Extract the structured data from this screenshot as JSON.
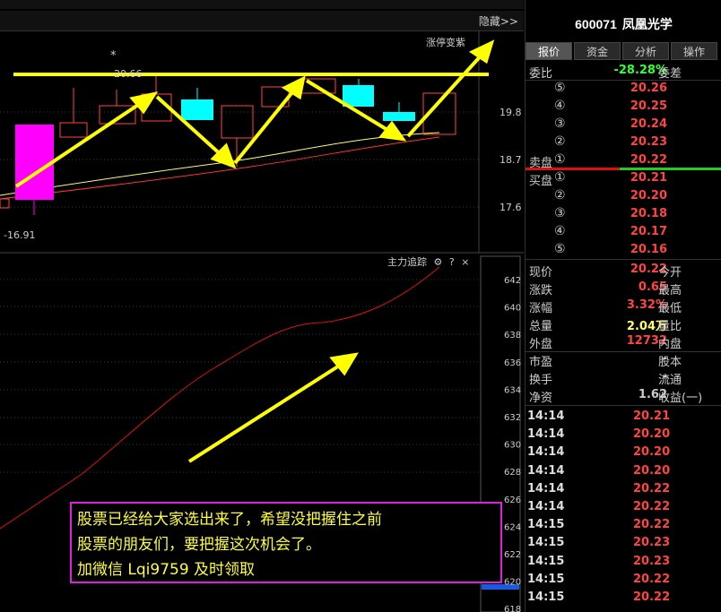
{
  "header": {
    "hide_label": "隐藏>>",
    "limit_label": "涨停变紫",
    "tracker_label": "主力追踪",
    "help_label": "?",
    "close_label": "×"
  },
  "kline": {
    "y_labels": [
      "19.8",
      "18.7",
      "17.6"
    ],
    "low_label": "-16.91",
    "high_label": "20.66",
    "star": "*",
    "candles_note": "K-line with MA lines"
  },
  "tracker_axis": [
    "642",
    "640",
    "638",
    "636",
    "634",
    "632",
    "630",
    "628",
    "626",
    "624",
    "622",
    "620",
    "618"
  ],
  "stock": {
    "code": "600071",
    "name": "凤凰光学"
  },
  "tabs": [
    "报价",
    "资金",
    "分析",
    "操作"
  ],
  "weibi": {
    "label": "委比",
    "value": "-28.28%",
    "label2": "委差"
  },
  "sell": [
    {
      "n": "⑤",
      "price": "20.26"
    },
    {
      "n": "④",
      "price": "20.25"
    },
    {
      "n": "③",
      "price": "20.24"
    },
    {
      "n": "②",
      "price": "20.23"
    },
    {
      "n": "①",
      "price": "20.22",
      "label": "卖盘"
    }
  ],
  "buy": [
    {
      "n": "①",
      "price": "20.21",
      "label": "买盘"
    },
    {
      "n": "②",
      "price": "20.20"
    },
    {
      "n": "③",
      "price": "20.18"
    },
    {
      "n": "④",
      "price": "20.17"
    },
    {
      "n": "⑤",
      "price": "20.16"
    }
  ],
  "quote": [
    {
      "a": "现价",
      "b": "20.22",
      "c": "今开"
    },
    {
      "a": "涨跌",
      "b": "0.65",
      "c": "最高"
    },
    {
      "a": "涨幅",
      "b": "3.32%",
      "c": "最低"
    },
    {
      "a": "总量",
      "b": "2.04万",
      "c": "量比"
    },
    {
      "a": "外盘",
      "b": "12732",
      "c": "内盘"
    }
  ],
  "info": [
    {
      "a": "市盈",
      "b": "-",
      "c": "股本"
    },
    {
      "a": "换手",
      "b": "-",
      "c": "流通"
    },
    {
      "a": "净资",
      "b": "1.62",
      "c": "收益(一)"
    }
  ],
  "ticks": [
    {
      "t": "14:14",
      "p": "20.21"
    },
    {
      "t": "14:14",
      "p": "20.20"
    },
    {
      "t": "14:14",
      "p": "20.20"
    },
    {
      "t": "14:14",
      "p": "20.20"
    },
    {
      "t": "14:14",
      "p": "20.22"
    },
    {
      "t": "14:14",
      "p": "20.22"
    },
    {
      "t": "14:15",
      "p": "20.22"
    },
    {
      "t": "14:15",
      "p": "20.23"
    },
    {
      "t": "14:15",
      "p": "20.23"
    },
    {
      "t": "14:15",
      "p": "20.22"
    },
    {
      "t": "14:15",
      "p": "20.22"
    }
  ],
  "note": {
    "line1": "股票已经给大家选出来了，希望没把握住之前",
    "line2": "股票的朋友们，要把握这次机会了。",
    "line3": "加微信 Lqi9759 及时领取"
  },
  "colors": {
    "up": "#ff4444",
    "down": "#00ffff",
    "limit": "#ff00ff",
    "arrow": "#ffff00"
  }
}
